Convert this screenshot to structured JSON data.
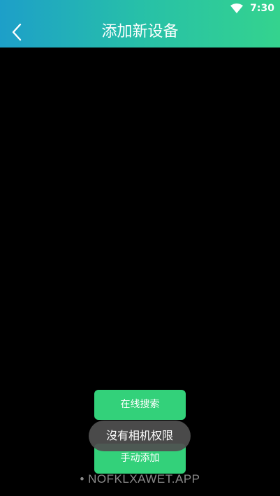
{
  "status_bar": {
    "time": "7:30",
    "wifi_icon": "wifi-icon"
  },
  "header": {
    "title": "添加新设备",
    "back_icon": "chevron-left-icon"
  },
  "buttons": {
    "online_search": "在线搜索",
    "manual_add": "手动添加"
  },
  "toast": {
    "message": "沒有相机权限"
  },
  "watermark": {
    "text": "• NOFKLXAWET.APP"
  },
  "colors": {
    "header_gradient_start": "#1d9fc9",
    "header_gradient_end": "#34d38e",
    "button_green": "#33d17a",
    "toast_bg": "#505050",
    "background": "#000000"
  }
}
